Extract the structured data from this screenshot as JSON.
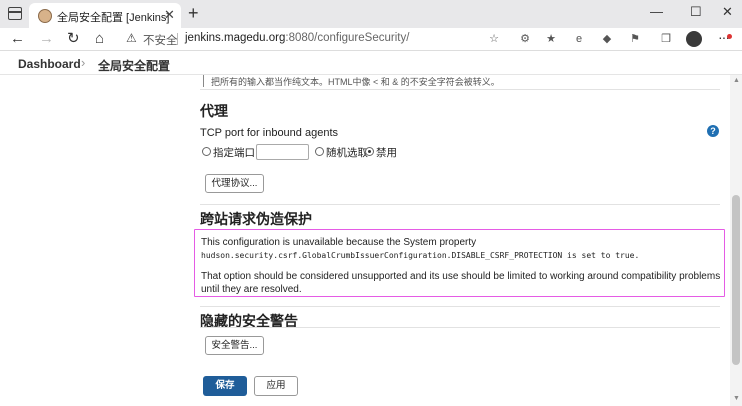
{
  "browser": {
    "tab_title": "全局安全配置 [Jenkins]",
    "tab_close": "✕",
    "new_tab": "+",
    "window_controls": [
      "—",
      "☐",
      "✕"
    ],
    "back": "←",
    "forward": "→",
    "reload": "↻",
    "home": "⌂",
    "warning_icon": "⚠",
    "insecure_label": "不安全",
    "url_host": "jenkins.magedu.org",
    "url_rest": ":8080/configureSecurity/",
    "more": "···",
    "extensions": [
      "☆",
      "⚙",
      "★",
      "e",
      "◆",
      "⚑",
      "❒",
      "♡"
    ]
  },
  "header": {
    "crumb_dashboard": "Dashboard",
    "crumb_separator": "›",
    "crumb_current": "全局安全配置"
  },
  "content": {
    "top_note": "把所有的输入都当作纯文本。HTML中像 < 和 & 的不安全字符会被转义。",
    "agents": {
      "title": "代理",
      "tcp_label": "TCP port for inbound agents",
      "help": "?",
      "radio_fixed": "指定端口 :",
      "port_value": "",
      "radio_random": "随机选取",
      "radio_disable": "禁用",
      "selected": "disable",
      "protocols_button": "代理协议..."
    },
    "csrf": {
      "title": "跨站请求伪造保护",
      "line1": "This configuration is unavailable because the System property",
      "line2": "hudson.security.csrf.GlobalCrumbIssuerConfiguration.DISABLE_CSRF_PROTECTION is set to true.",
      "line3": "That option should be considered unsupported and its use should be limited to working around compatibility problems until they are resolved."
    },
    "hidden_warnings": {
      "title": "隐藏的安全警告",
      "button": "安全警告..."
    },
    "actions": {
      "save": "保存",
      "apply": "应用"
    }
  },
  "colors": {
    "primary": "#1f5d99",
    "highlight_border": "#e55be5",
    "help_icon": "#1f6fb2"
  }
}
